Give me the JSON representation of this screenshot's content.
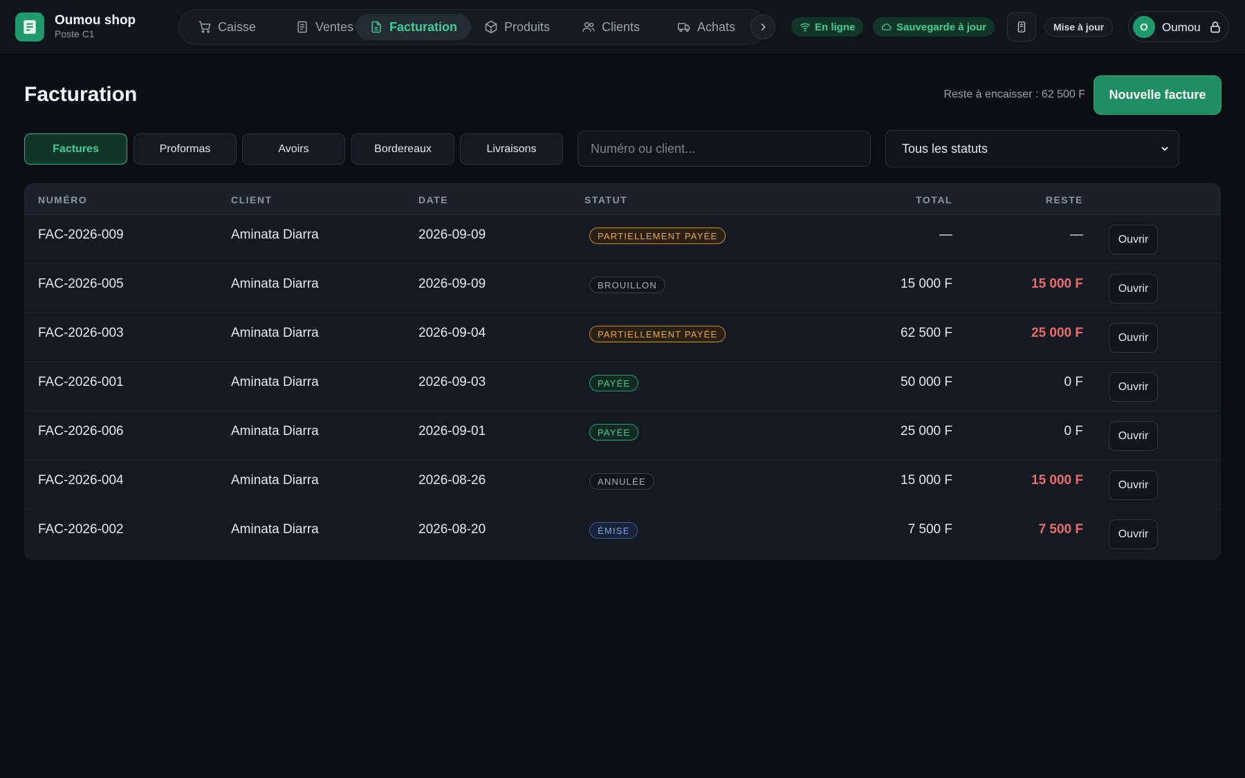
{
  "brand": {
    "name": "Oumou shop",
    "subtitle": "Poste C1"
  },
  "nav": {
    "items": [
      {
        "label": "Caisse",
        "icon": "cart-icon",
        "active": false
      },
      {
        "label": "Ventes",
        "icon": "receipt-icon",
        "active": false
      },
      {
        "label": "Facturation",
        "icon": "document-icon",
        "active": true
      },
      {
        "label": "Produits",
        "icon": "box-icon",
        "active": false
      },
      {
        "label": "Clients",
        "icon": "users-icon",
        "active": false
      },
      {
        "label": "Achats",
        "icon": "truck-icon",
        "active": false
      }
    ]
  },
  "status": {
    "online": "En ligne",
    "backup": "Sauvegarde à jour",
    "update": "Mise à jour"
  },
  "user": {
    "initial": "O",
    "name": "Oumou"
  },
  "page": {
    "title": "Facturation",
    "remaining": "Reste à encaisser : 62 500 F",
    "new_invoice": "Nouvelle facture"
  },
  "tabs": [
    {
      "label": "Factures",
      "active": true
    },
    {
      "label": "Proformas",
      "active": false
    },
    {
      "label": "Avoirs",
      "active": false
    },
    {
      "label": "Bordereaux",
      "active": false
    },
    {
      "label": "Livraisons",
      "active": false
    }
  ],
  "filters": {
    "search_placeholder": "Numéro ou client...",
    "status_selected": "Tous les statuts"
  },
  "table": {
    "headers": {
      "number": "NUMÉRO",
      "client": "CLIENT",
      "date": "DATE",
      "status": "STATUT",
      "total": "TOTAL",
      "remaining": "RESTE"
    },
    "open_label": "Ouvrir",
    "rows": [
      {
        "number": "FAC-2026-009",
        "client": "Aminata Diarra",
        "date": "2026-09-09",
        "status": "PARTIELLEMENT PAYÉE",
        "status_kind": "partial",
        "total": "—",
        "remaining": "—",
        "remaining_due": false
      },
      {
        "number": "FAC-2026-005",
        "client": "Aminata Diarra",
        "date": "2026-09-09",
        "status": "BROUILLON",
        "status_kind": "draft",
        "total": "15 000 F",
        "remaining": "15 000 F",
        "remaining_due": true
      },
      {
        "number": "FAC-2026-003",
        "client": "Aminata Diarra",
        "date": "2026-09-04",
        "status": "PARTIELLEMENT PAYÉE",
        "status_kind": "partial",
        "total": "62 500 F",
        "remaining": "25 000 F",
        "remaining_due": true
      },
      {
        "number": "FAC-2026-001",
        "client": "Aminata Diarra",
        "date": "2026-09-03",
        "status": "PAYÉE",
        "status_kind": "paid",
        "total": "50 000 F",
        "remaining": "0 F",
        "remaining_due": false
      },
      {
        "number": "FAC-2026-006",
        "client": "Aminata Diarra",
        "date": "2026-09-01",
        "status": "PAYÉE",
        "status_kind": "paid",
        "total": "25 000 F",
        "remaining": "0 F",
        "remaining_due": false
      },
      {
        "number": "FAC-2026-004",
        "client": "Aminata Diarra",
        "date": "2026-08-26",
        "status": "ANNULÉE",
        "status_kind": "void",
        "total": "15 000 F",
        "remaining": "15 000 F",
        "remaining_due": true
      },
      {
        "number": "FAC-2026-002",
        "client": "Aminata Diarra",
        "date": "2026-08-20",
        "status": "ÉMISE",
        "status_kind": "issued",
        "total": "7 500 F",
        "remaining": "7 500 F",
        "remaining_due": true
      }
    ]
  },
  "colors": {
    "accent": "#3ccf95",
    "brand": "#1f9a6c",
    "due": "#ef6b6b",
    "background": "#0b0f14"
  }
}
